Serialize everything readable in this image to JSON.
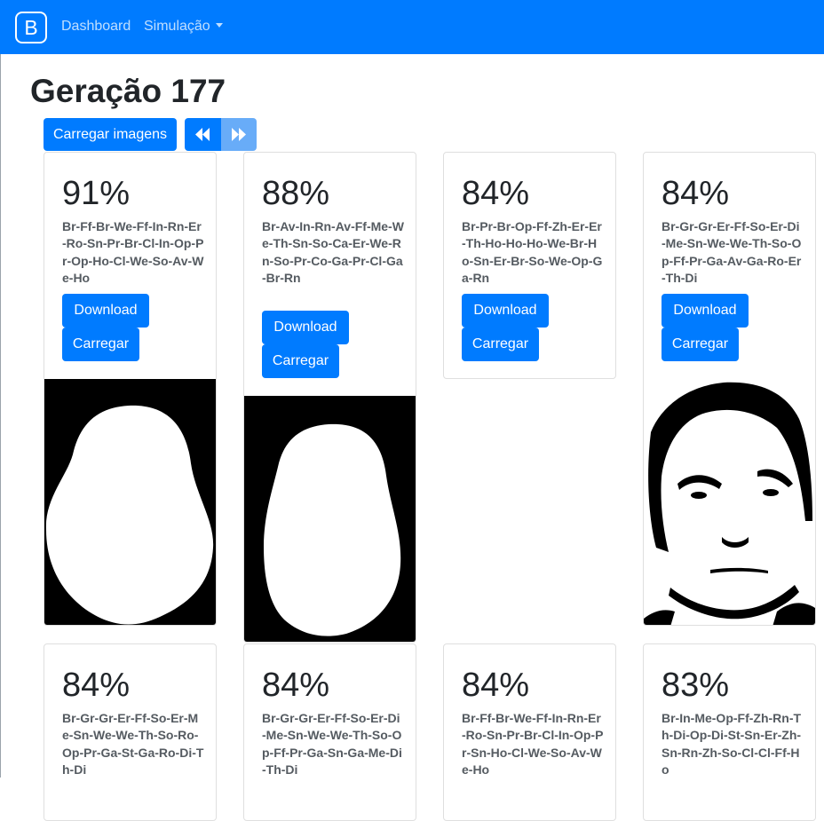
{
  "navbar": {
    "brand": "B",
    "links": [
      "Dashboard",
      "Simulação"
    ]
  },
  "page": {
    "title": "Geração 177",
    "load_all_label": "Carregar imagens"
  },
  "cards": [
    {
      "score": "91%",
      "genome": "Br-Ff-Br-We-Ff-In-Rn-Er-Ro-Sn-Pr-Br-Cl-In-Op-Pr-Op-Ho-Cl-We-So-Av-We-Ho",
      "download": "Download",
      "load": "Carregar",
      "image": "face-mask-silhouette"
    },
    {
      "score": "88%",
      "genome": "Br-Av-In-Rn-Av-Ff-Me-We-Th-Sn-So-Ca-Er-We-Rn-So-Pr-Co-Ga-Pr-Cl-Ga-Br-Rn",
      "download": "Download",
      "load": "Carregar",
      "image": "face-mask-silhouette"
    },
    {
      "score": "84%",
      "genome": "Br-Pr-Br-Op-Ff-Zh-Er-Er-Th-Ho-Ho-Ho-We-Br-Ho-Sn-Er-Br-So-We-Op-Ga-Rn",
      "download": "Download",
      "load": "Carregar",
      "image": ""
    },
    {
      "score": "84%",
      "genome": "Br-Gr-Gr-Er-Ff-So-Er-Di-Me-Sn-We-We-Th-So-Op-Ff-Pr-Ga-Av-Ga-Ro-Er-Th-Di",
      "download": "Download",
      "load": "Carregar",
      "image": "face-threshold-photo"
    },
    {
      "score": "84%",
      "genome": "Br-Gr-Gr-Er-Ff-So-Er-Me-Sn-We-We-Th-So-Ro-Op-Pr-Ga-St-Ga-Ro-Di-Th-Di"
    },
    {
      "score": "84%",
      "genome": "Br-Gr-Gr-Er-Ff-So-Er-Di-Me-Sn-We-We-Th-So-Op-Ff-Pr-Ga-Sn-Ga-Me-Di-Th-Di"
    },
    {
      "score": "84%",
      "genome": "Br-Ff-Br-We-Ff-In-Rn-Er-Ro-Sn-Pr-Br-Cl-In-Op-Pr-Sn-Ho-Cl-We-So-Av-We-Ho"
    },
    {
      "score": "83%",
      "genome": "Br-In-Me-Op-Ff-Zh-Rn-Th-Di-Op-Di-St-Sn-Er-Zh-Sn-Rn-Zh-So-Cl-Cl-Ff-Ho"
    }
  ],
  "colors": {
    "primary": "#007bff",
    "primary_light": "#68acf8",
    "text": "#212529",
    "genome_text": "#555b61"
  }
}
